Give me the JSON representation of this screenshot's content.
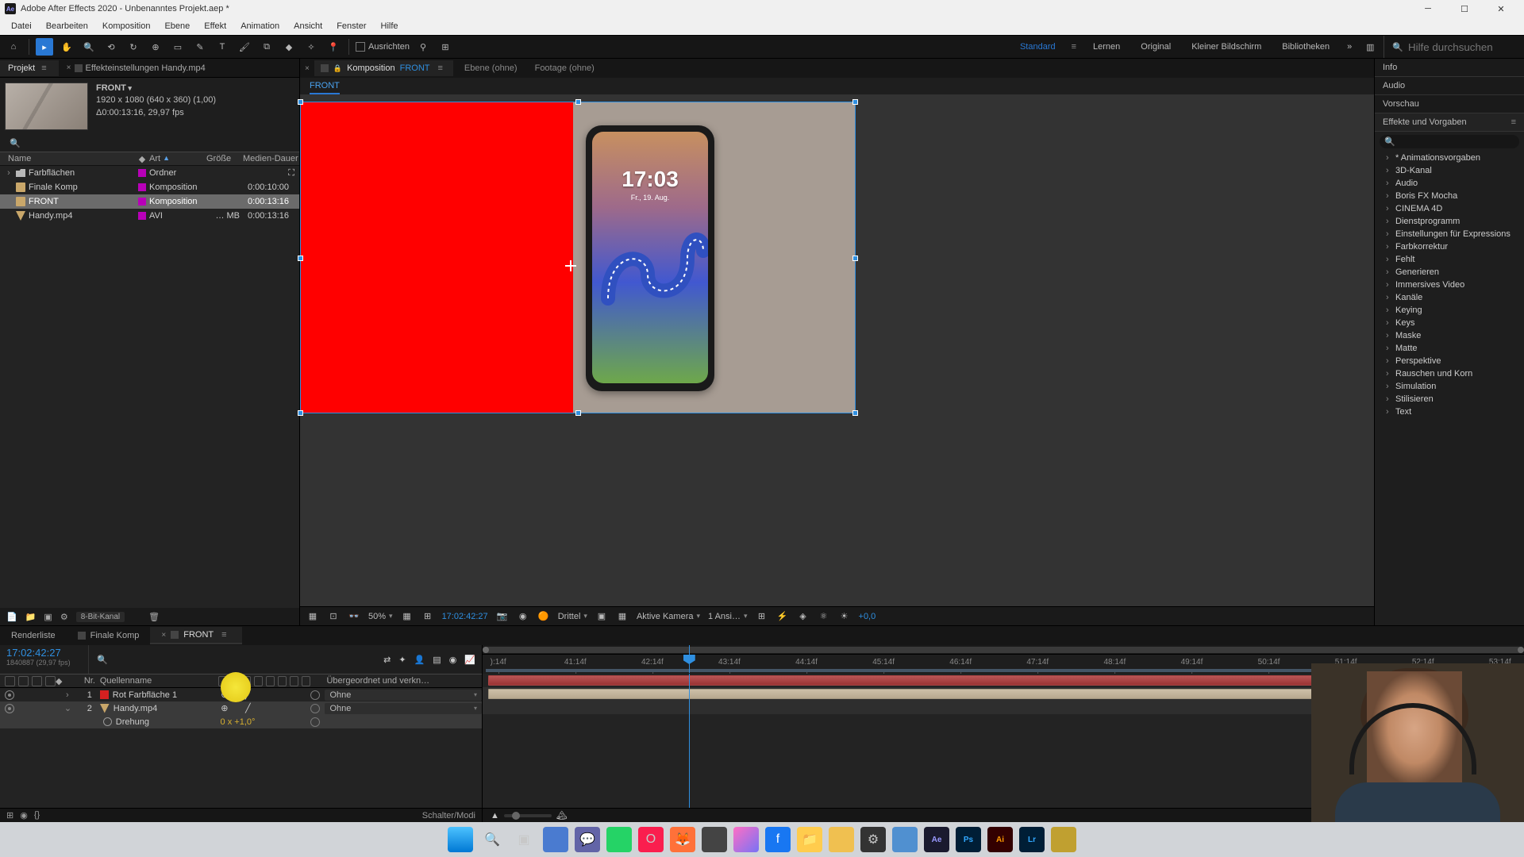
{
  "window": {
    "title": "Adobe After Effects 2020 - Unbenanntes Projekt.aep *"
  },
  "menu": [
    "Datei",
    "Bearbeiten",
    "Komposition",
    "Ebene",
    "Effekt",
    "Animation",
    "Ansicht",
    "Fenster",
    "Hilfe"
  ],
  "toolbar": {
    "align_label": "Ausrichten"
  },
  "workspaces": {
    "items": [
      "Standard",
      "Lernen",
      "Original",
      "Kleiner Bildschirm",
      "Bibliotheken"
    ],
    "active": 0,
    "search_placeholder": "Hilfe durchsuchen"
  },
  "project_panel": {
    "tab_project": "Projekt",
    "tab_effect": "Effekteinstellungen Handy.mp4",
    "header": {
      "name": "FRONT",
      "line1": "1920 x 1080 (640 x 360) (1,00)",
      "line2": "Δ0:00:13:16, 29,97 fps"
    },
    "cols": {
      "name": "Name",
      "type": "Art",
      "size": "Größe",
      "dur": "Medien-Dauer"
    },
    "items": [
      {
        "name": "Farbflächen",
        "type": "Ordner",
        "size": "",
        "dur": "",
        "icon": "folder",
        "twirl": "›"
      },
      {
        "name": "Finale Komp",
        "type": "Komposition",
        "size": "",
        "dur": "0:00:10:00",
        "icon": "comp",
        "twirl": ""
      },
      {
        "name": "FRONT",
        "type": "Komposition",
        "size": "",
        "dur": "0:00:13:16",
        "icon": "comp",
        "twirl": "",
        "selected": true
      },
      {
        "name": "Handy.mp4",
        "type": "AVI",
        "size": "… MB",
        "dur": "0:00:13:16",
        "icon": "avi",
        "twirl": ""
      }
    ],
    "footer_depth": "8-Bit-Kanal"
  },
  "center": {
    "tab_comp_prefix": "Komposition",
    "tab_comp_name": "FRONT",
    "tab_layer": "Ebene (ohne)",
    "tab_footage": "Footage (ohne)",
    "breadcrumb": "FRONT",
    "phone_time": "17:03",
    "phone_date": "Fr., 19. Aug.",
    "footer": {
      "zoom": "50%",
      "timecode": "17:02:42:27",
      "res": "Drittel",
      "camera": "Aktive Kamera",
      "views": "1 Ansi…",
      "exposure": "+0,0"
    }
  },
  "right": {
    "sections": [
      "Info",
      "Audio",
      "Vorschau"
    ],
    "fx_title": "Effekte und Vorgaben",
    "fx_items": [
      "* Animationsvorgaben",
      "3D-Kanal",
      "Audio",
      "Boris FX Mocha",
      "CINEMA 4D",
      "Dienstprogramm",
      "Einstellungen für Expressions",
      "Farbkorrektur",
      "Fehlt",
      "Generieren",
      "Immersives Video",
      "Kanäle",
      "Keying",
      "Keys",
      "Maske",
      "Matte",
      "Perspektive",
      "Rauschen und Korn",
      "Simulation",
      "Stilisieren",
      "Text"
    ]
  },
  "timeline": {
    "tabs": {
      "render": "Renderliste",
      "finale": "Finale Komp",
      "front": "FRONT"
    },
    "current_time": "17:02:42:27",
    "current_sub": "1840887 (29,97 fps)",
    "col_nr": "Nr.",
    "col_source": "Quellenname",
    "col_parent": "Übergeordnet und verkn…",
    "ruler": [
      "):14f",
      "41:14f",
      "42:14f",
      "43:14f",
      "44:14f",
      "45:14f",
      "46:14f",
      "47:14f",
      "48:14f",
      "49:14f",
      "50:14f",
      "51:14f",
      "52:14f",
      "53:14f"
    ],
    "layers": [
      {
        "nr": "1",
        "name": "Rot Farbfläche 1",
        "label": "red",
        "parent": "Ohne",
        "selected": false
      },
      {
        "nr": "2",
        "name": "Handy.mp4",
        "label": "tan",
        "parent": "Ohne",
        "selected": true
      }
    ],
    "prop_rotation": {
      "label": "Drehung",
      "value": "0 x +1,0°"
    },
    "footer_switches": "Schalter/Modi"
  },
  "taskbar": {
    "apps": [
      "windows",
      "search",
      "taskview",
      "widgets",
      "teams",
      "whatsapp",
      "opera",
      "firefox",
      "app1",
      "messenger",
      "facebook",
      "explorer",
      "app2",
      "obs",
      "app3",
      "ae",
      "ps",
      "ai",
      "lr",
      "app4"
    ]
  }
}
